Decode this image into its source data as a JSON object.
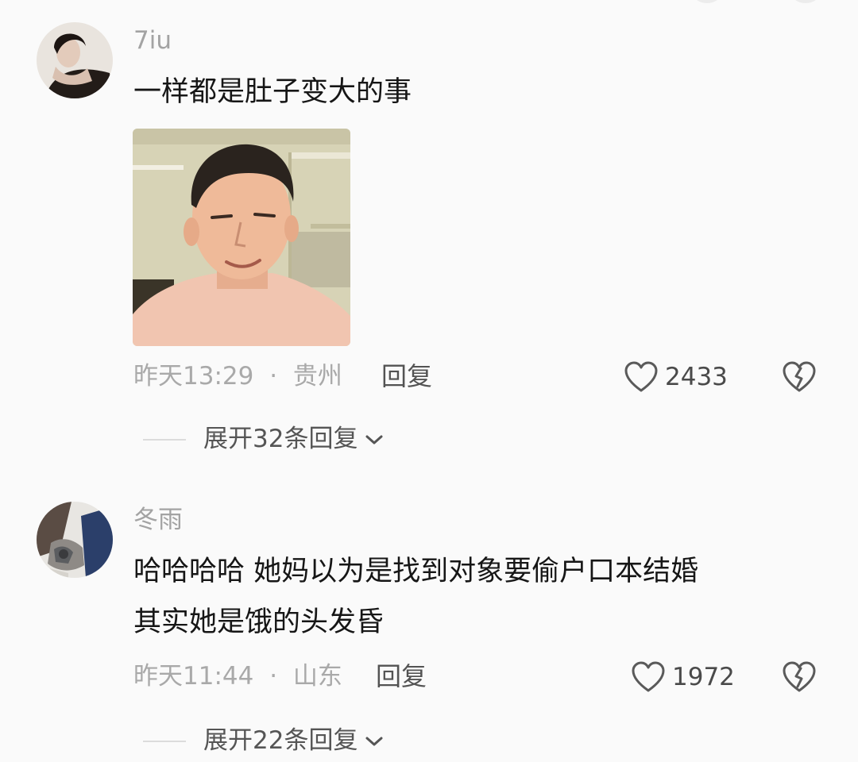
{
  "comments": [
    {
      "username": "7iu",
      "text": "一样都是肚子变大的事",
      "time": "昨天13:29",
      "separator": "·",
      "location": "贵州",
      "reply_label": "回复",
      "like_count": "2433",
      "expand_label": "展开32条回复",
      "has_image": true
    },
    {
      "username": "冬雨",
      "text_line1": "哈哈哈哈 她妈以为是找到对象要偷户口本结婚",
      "text_line2": "其实她是饿的头发昏",
      "time": "昨天11:44",
      "separator": "·",
      "location": "山东",
      "reply_label": "回复",
      "like_count": "1972",
      "expand_label": "展开22条回复",
      "has_image": false
    }
  ],
  "icons": {
    "like": "heart-outline-icon",
    "dislike": "broken-heart-icon",
    "expand": "chevron-down-icon"
  },
  "colors": {
    "background": "#fafafa",
    "username": "#a3a3a3",
    "meta": "#a9a9a9",
    "text": "#161616"
  }
}
